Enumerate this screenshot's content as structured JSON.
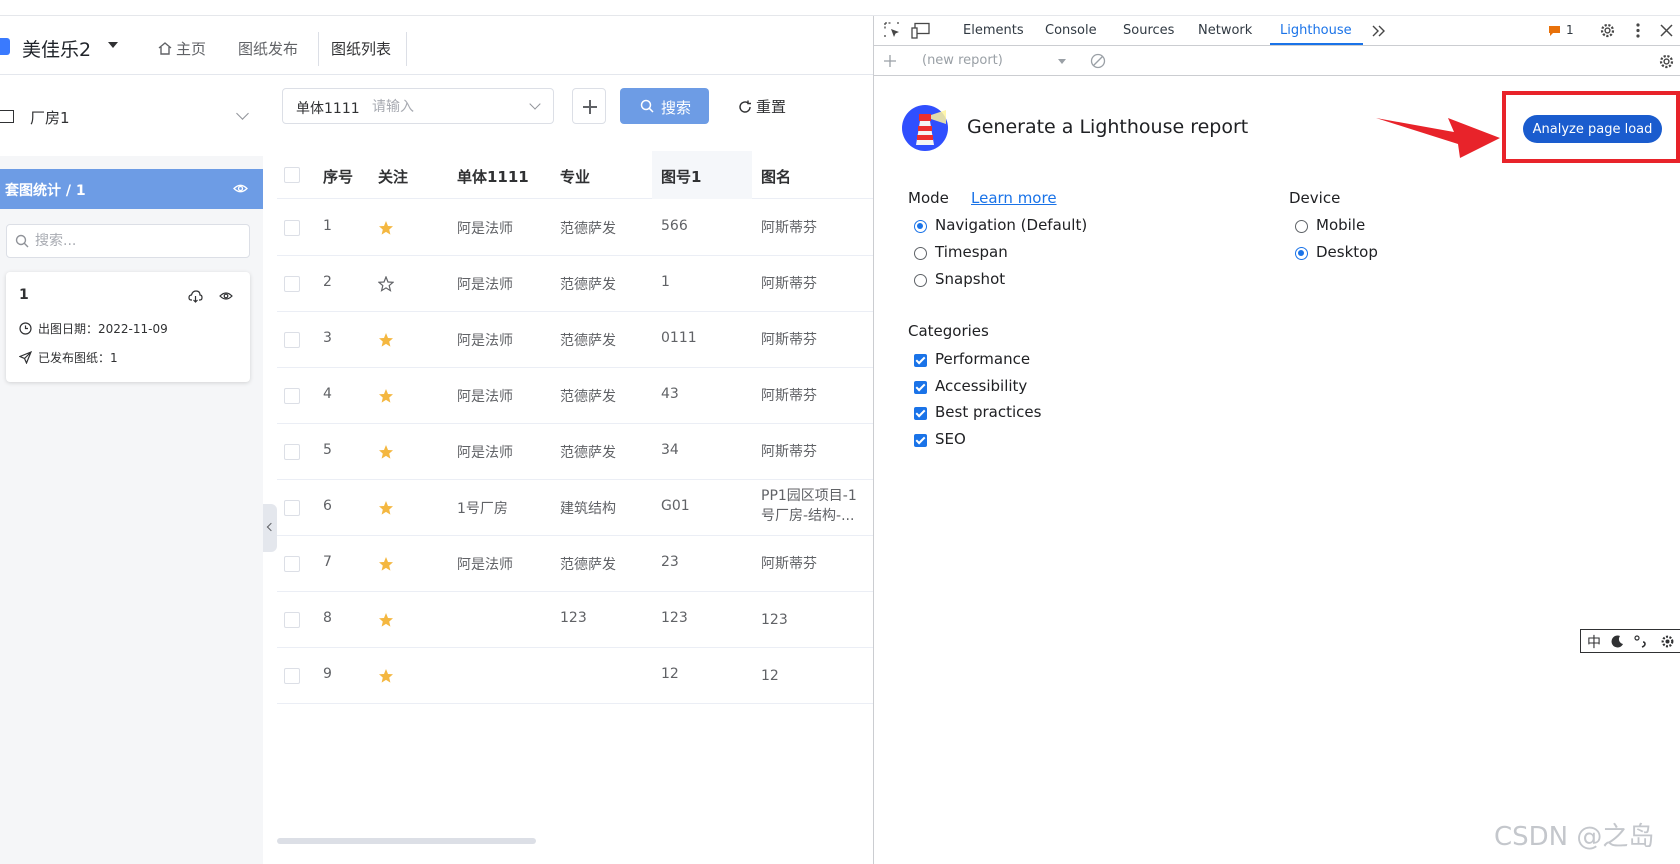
{
  "app": {
    "project_name": "美佳乐2",
    "nav": [
      "主页",
      "图纸发布",
      "图纸列表"
    ],
    "active_nav": "图纸列表"
  },
  "sidebar": {
    "factory": "厂房1",
    "set_title": "套图统计 / 1",
    "search_placeholder": "搜索...",
    "card": {
      "title": "1",
      "date_label": "出图日期：2022-11-09",
      "published_label": "已发布图纸：1"
    }
  },
  "toolbar": {
    "select_label": "单体1111",
    "select_placeholder": "请输入",
    "search_label": "搜索",
    "reset_label": "重置"
  },
  "table": {
    "columns": [
      "序号",
      "关注",
      "单体1111",
      "专业",
      "图号1",
      "图名"
    ],
    "rows": [
      {
        "no": "1",
        "starred": true,
        "unit": "阿是法师",
        "major": "范德萨发",
        "code": "566",
        "name": "阿斯蒂芬"
      },
      {
        "no": "2",
        "starred": false,
        "unit": "阿是法师",
        "major": "范德萨发",
        "code": "1",
        "name": "阿斯蒂芬"
      },
      {
        "no": "3",
        "starred": true,
        "unit": "阿是法师",
        "major": "范德萨发",
        "code": "0111",
        "name": "阿斯蒂芬"
      },
      {
        "no": "4",
        "starred": true,
        "unit": "阿是法师",
        "major": "范德萨发",
        "code": "43",
        "name": "阿斯蒂芬"
      },
      {
        "no": "5",
        "starred": true,
        "unit": "阿是法师",
        "major": "范德萨发",
        "code": "34",
        "name": "阿斯蒂芬"
      },
      {
        "no": "6",
        "starred": true,
        "unit": "1号厂房",
        "major": "建筑结构",
        "code": "G01",
        "name": "PP1园区项目-1号厂房-结构-..."
      },
      {
        "no": "7",
        "starred": true,
        "unit": "阿是法师",
        "major": "范德萨发",
        "code": "23",
        "name": "阿斯蒂芬"
      },
      {
        "no": "8",
        "starred": true,
        "unit": "",
        "major": "123",
        "code": "123",
        "name": "123"
      },
      {
        "no": "9",
        "starred": true,
        "unit": "",
        "major": "",
        "code": "12",
        "name": "12"
      }
    ]
  },
  "devtools": {
    "tabs": [
      "Elements",
      "Console",
      "Sources",
      "Network",
      "Lighthouse"
    ],
    "active_tab": "Lighthouse",
    "issues_count": "1",
    "report_placeholder": "(new report)",
    "title": "Generate a Lighthouse report",
    "analyze_label": "Analyze page load",
    "mode_label": "Mode",
    "learn_more": "Learn more",
    "modes": [
      "Navigation (Default)",
      "Timespan",
      "Snapshot"
    ],
    "device_label": "Device",
    "devices": [
      "Mobile",
      "Desktop"
    ],
    "categories_label": "Categories",
    "categories": [
      "Performance",
      "Accessibility",
      "Best practices",
      "SEO"
    ]
  },
  "ime": {
    "lang": "中"
  },
  "watermark": "CSDN @之岛",
  "colors": {
    "accent_blue": "#6d9ce5",
    "lighthouse_blue": "#1a5cce",
    "annotation_red": "#e8232a",
    "star": "#f4b740"
  }
}
